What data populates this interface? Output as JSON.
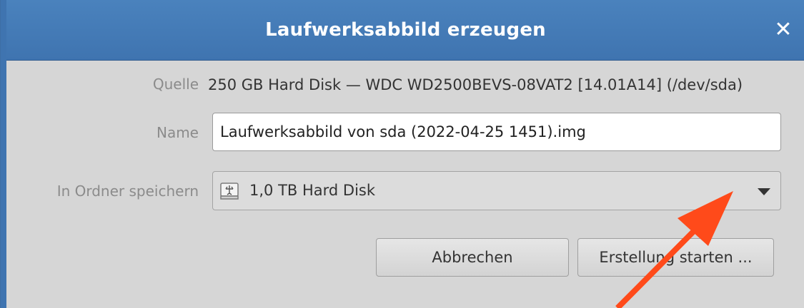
{
  "window": {
    "title": "Laufwerksabbild erzeugen",
    "close_icon": "close-icon",
    "accent_color": "#4a82bd"
  },
  "fields": {
    "source": {
      "label": "Quelle",
      "value": "250 GB Hard Disk — WDC WD2500BEVS-08VAT2 [14.01A14] (/dev/sda)"
    },
    "name": {
      "label": "Name",
      "value": "Laufwerksabbild von sda (2022-04-25 1451).img"
    },
    "folder": {
      "label": "In Ordner speichern",
      "selected": "1,0 TB Hard Disk",
      "icon": "hard-disk-icon"
    }
  },
  "buttons": {
    "cancel": "Abbrechen",
    "start": "Erstellung starten ..."
  },
  "annotation": {
    "color": "#ff4a1a",
    "type": "arrow"
  }
}
